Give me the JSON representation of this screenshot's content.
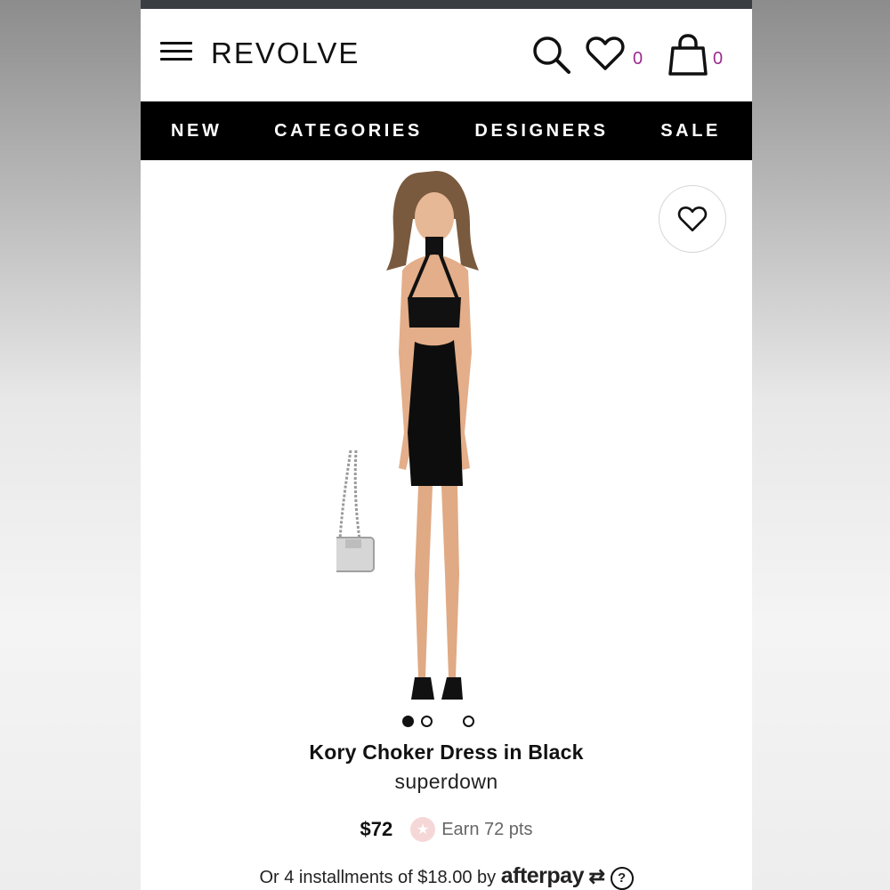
{
  "header": {
    "logo": "REVOLVE",
    "wishlist_count": "0",
    "bag_count": "0"
  },
  "nav": {
    "items": [
      {
        "label": "NEW"
      },
      {
        "label": "CATEGORIES"
      },
      {
        "label": "DESIGNERS"
      },
      {
        "label": "SALE"
      }
    ]
  },
  "product": {
    "title": "Kory Choker Dress in Black",
    "brand": "superdown",
    "price": "$72",
    "points": "Earn 72 pts",
    "image_count": 3,
    "active_image": 1,
    "afterpay_prefix": "Or 4 installments of $18.00 by",
    "afterpay_logo": "afterpay",
    "help_symbol": "?"
  },
  "colors": {
    "accent_count": "#9b2a8f",
    "nav_bg": "#000000",
    "points_badge": "#f6d7d7"
  },
  "icons": [
    "menu-icon",
    "search-icon",
    "heart-icon",
    "bag-icon",
    "star-icon",
    "help-icon"
  ]
}
